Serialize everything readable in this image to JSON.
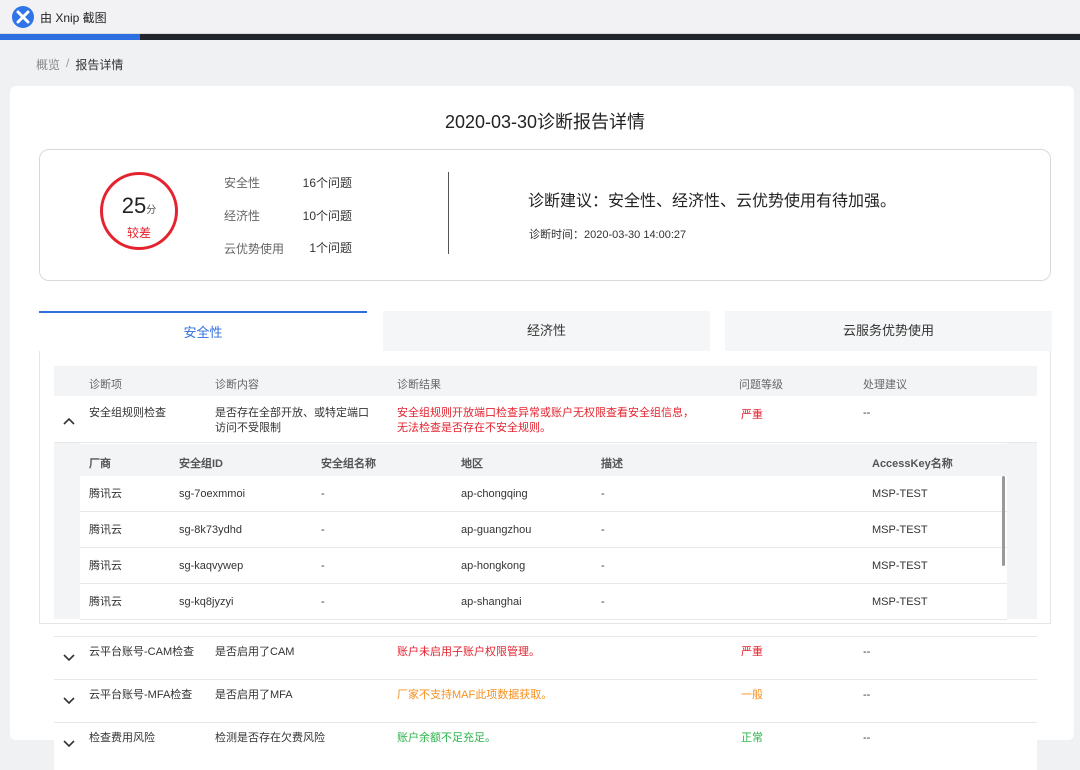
{
  "window": {
    "title": "由 Xnip 截图"
  },
  "progress": {
    "value_percent": 13
  },
  "breadcrumb": {
    "home": "概览",
    "separator": "/",
    "current": "报告详情"
  },
  "report": {
    "title": "2020-03-30诊断报告详情",
    "score": "25",
    "score_unit": "分",
    "level": "较差",
    "metrics": [
      {
        "name": "安全性",
        "value": "16个问题"
      },
      {
        "name": "经济性",
        "value": "10个问题"
      },
      {
        "name": "云优势使用",
        "value": "1个问题"
      }
    ],
    "advice": "诊断建议：安全性、经济性、云优势使用有待加强。",
    "time": "诊断时间：2020-03-30 14:00:27"
  },
  "tabs": [
    {
      "label": "安全性",
      "active": true
    },
    {
      "label": "经济性",
      "active": false
    },
    {
      "label": "云服务优势使用",
      "active": false
    }
  ],
  "table": {
    "headers": [
      "诊断项",
      "诊断内容",
      "诊断结果",
      "问题等级",
      "处理建议"
    ],
    "rows": [
      {
        "item": "安全组规则检查",
        "content": "是否存在全部开放、或特定端口访问不受限制",
        "result": "安全组规则开放端口检查异常或账户无权限查看安全组信息，无法检查是否存在不安全规则。",
        "level": "严重",
        "suggestion": "--",
        "expanded": true
      },
      {
        "item": "云平台账号-CAM检查",
        "content": "是否启用了CAM",
        "result": "账户未启用子账户权限管理。",
        "level": "严重",
        "suggestion": "--",
        "expanded": false
      },
      {
        "item": "云平台账号-MFA检查",
        "content": "是否启用了MFA",
        "result": "厂家不支持MAF此项数据获取。",
        "level": "一般",
        "suggestion": "--",
        "expanded": false
      },
      {
        "item": "检查费用风险",
        "content": "检测是否存在欠费风险",
        "result": "账户余额不足充足。",
        "level": "正常",
        "suggestion": "--",
        "expanded": false
      }
    ]
  },
  "subtable": {
    "headers": [
      "厂商",
      "安全组ID",
      "安全组名称",
      "地区",
      "描述",
      "AccessKey名称"
    ],
    "rows": [
      [
        "腾讯云",
        "sg-7oexmmoi",
        "-",
        "ap-chongqing",
        "-",
        "MSP-TEST"
      ],
      [
        "腾讯云",
        "sg-8k73ydhd",
        "-",
        "ap-guangzhou",
        "-",
        "MSP-TEST"
      ],
      [
        "腾讯云",
        "sg-kaqvywep",
        "-",
        "ap-hongkong",
        "-",
        "MSP-TEST"
      ],
      [
        "腾讯云",
        "sg-kq8jyzyi",
        "-",
        "ap-shanghai",
        "-",
        "MSP-TEST"
      ]
    ]
  },
  "colors": {
    "accent": "#2d6fe0",
    "danger": "#e4232f",
    "warning": "#f5901f",
    "success": "#2bb34a"
  }
}
